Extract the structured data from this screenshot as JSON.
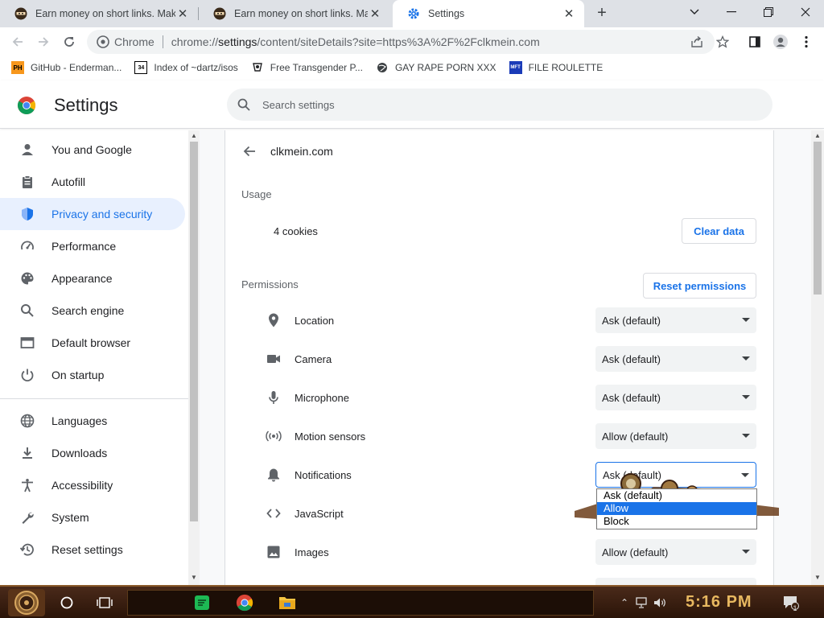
{
  "tabs": [
    {
      "title": "Earn money on short links. Make",
      "active": false
    },
    {
      "title": "Earn money on short links. Make",
      "active": false
    },
    {
      "title": "Settings",
      "active": true
    }
  ],
  "toolbar": {
    "chip": "Chrome",
    "url_prefix": "chrome://",
    "url_host": "settings",
    "url_rest": "/content/siteDetails?site=https%3A%2F%2Fclkmein.com"
  },
  "bookmarks": [
    {
      "label": "GitHub - Enderman...",
      "icon": "ph-logo-icon",
      "badge": "PH"
    },
    {
      "label": "Index of ~dartz/isos",
      "icon": "site-34-icon",
      "badge": "34"
    },
    {
      "label": "Free Transgender P...",
      "icon": "site-logo-icon",
      "badge": ""
    },
    {
      "label": "GAY RAPE PORN XXX",
      "icon": "globe-icon",
      "badge": ""
    },
    {
      "label": "FILE ROULETTE",
      "icon": "mft-icon",
      "badge": "MFT"
    }
  ],
  "header": {
    "title": "Settings",
    "search_placeholder": "Search settings"
  },
  "sidebar": {
    "items": [
      {
        "label": "You and Google",
        "icon": "person-icon",
        "active": false
      },
      {
        "label": "Autofill",
        "icon": "clipboard-icon",
        "active": false
      },
      {
        "label": "Privacy and security",
        "icon": "shield-icon",
        "active": true
      },
      {
        "label": "Performance",
        "icon": "speedometer-icon",
        "active": false
      },
      {
        "label": "Appearance",
        "icon": "palette-icon",
        "active": false
      },
      {
        "label": "Search engine",
        "icon": "search-icon",
        "active": false
      },
      {
        "label": "Default browser",
        "icon": "browser-icon",
        "active": false
      },
      {
        "label": "On startup",
        "icon": "power-icon",
        "active": false
      },
      {
        "label": "Languages",
        "icon": "globe-icon",
        "active": false
      },
      {
        "label": "Downloads",
        "icon": "download-icon",
        "active": false
      },
      {
        "label": "Accessibility",
        "icon": "accessibility-icon",
        "active": false
      },
      {
        "label": "System",
        "icon": "wrench-icon",
        "active": false
      },
      {
        "label": "Reset settings",
        "icon": "reset-icon",
        "active": false
      }
    ]
  },
  "site": {
    "name": "clkmein.com",
    "usage_heading": "Usage",
    "cookies": "4 cookies",
    "clear_data": "Clear data",
    "permissions_heading": "Permissions",
    "reset_permissions": "Reset permissions",
    "permissions": [
      {
        "label": "Location",
        "icon": "location-pin-icon",
        "value": "Ask (default)"
      },
      {
        "label": "Camera",
        "icon": "camera-icon",
        "value": "Ask (default)"
      },
      {
        "label": "Microphone",
        "icon": "microphone-icon",
        "value": "Ask (default)"
      },
      {
        "label": "Motion sensors",
        "icon": "motion-sensor-icon",
        "value": "Allow (default)"
      },
      {
        "label": "Notifications",
        "icon": "bell-icon",
        "value": "Ask (default)",
        "open": true
      },
      {
        "label": "JavaScript",
        "icon": "code-icon",
        "value": ""
      },
      {
        "label": "Images",
        "icon": "image-icon",
        "value": "Allow (default)"
      }
    ],
    "dropdown_options": [
      "Ask (default)",
      "Allow",
      "Block"
    ],
    "dropdown_selected": "Allow"
  },
  "taskbar": {
    "clock": "5:16 PM",
    "notification_count": "1"
  },
  "colors": {
    "accent": "#1a73e8",
    "active_nav_bg": "#e8f0fe",
    "tab_strip": "#dee1e6"
  }
}
